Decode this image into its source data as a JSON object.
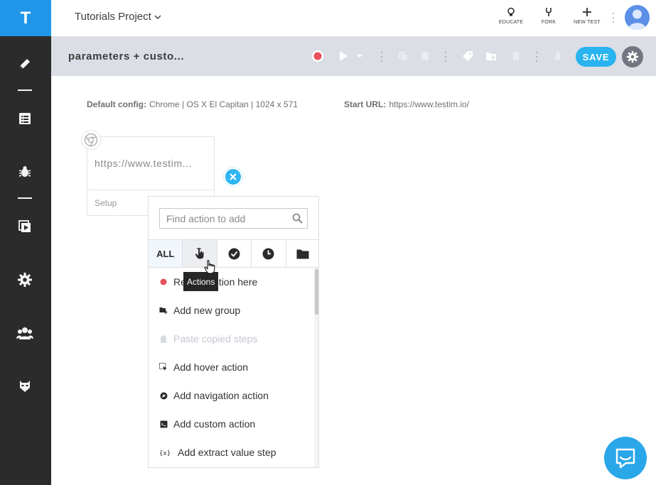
{
  "app": {
    "logo": "T"
  },
  "header": {
    "project_name": "Tutorials Project",
    "tools": [
      {
        "label": "EDUCATE",
        "icon": "lightbulb-icon"
      },
      {
        "label": "FORK",
        "icon": "fork-icon"
      },
      {
        "label": "NEW TEST",
        "icon": "plus-icon"
      }
    ]
  },
  "sidebar": {
    "items": [
      {
        "icon": "pencil-icon"
      },
      {
        "icon": "list-icon"
      },
      {
        "icon": "bug-icon"
      },
      {
        "icon": "play-runs-icon"
      },
      {
        "icon": "gear-icon"
      },
      {
        "icon": "team-icon"
      },
      {
        "icon": "mask-icon"
      }
    ]
  },
  "toolbar": {
    "test_title": "parameters + custo...",
    "save_label": "SAVE"
  },
  "config": {
    "default_label": "Default config:",
    "default_value": "Chrome | OS X El Capitan | 1024 x 571",
    "start_label": "Start URL:",
    "start_value": "https://www.testim.io/"
  },
  "setup": {
    "url": "https://www.testim...",
    "label": "Setup"
  },
  "panel": {
    "search_placeholder": "Find action to add",
    "tabs": [
      {
        "label": "ALL",
        "icon": ""
      },
      {
        "label": "",
        "icon": "hand-pointer-icon"
      },
      {
        "label": "",
        "icon": "check-circle-icon"
      },
      {
        "label": "",
        "icon": "clock-icon"
      },
      {
        "label": "",
        "icon": "folder-icon"
      }
    ],
    "items": [
      {
        "label": "Record action here",
        "icon": "record-dot-icon",
        "disabled": false
      },
      {
        "label": "Add new group",
        "icon": "add-group-icon",
        "disabled": false
      },
      {
        "label": "Paste copied steps",
        "icon": "clipboard-icon",
        "disabled": true
      },
      {
        "label": "Add hover action",
        "icon": "hover-icon",
        "disabled": false
      },
      {
        "label": "Add navigation action",
        "icon": "navigation-icon",
        "disabled": false
      },
      {
        "label": "Add custom action",
        "icon": "code-icon",
        "disabled": false
      },
      {
        "label": "Add extract value step",
        "icon": "extract-icon",
        "disabled": false
      }
    ]
  },
  "tooltip": {
    "text": "Actions"
  },
  "colors": {
    "brand": "#2196e8",
    "accent": "#29b4f0",
    "record": "#e8505b",
    "sidebar": "#2b2b2b",
    "toolbar": "#dcdee6"
  }
}
